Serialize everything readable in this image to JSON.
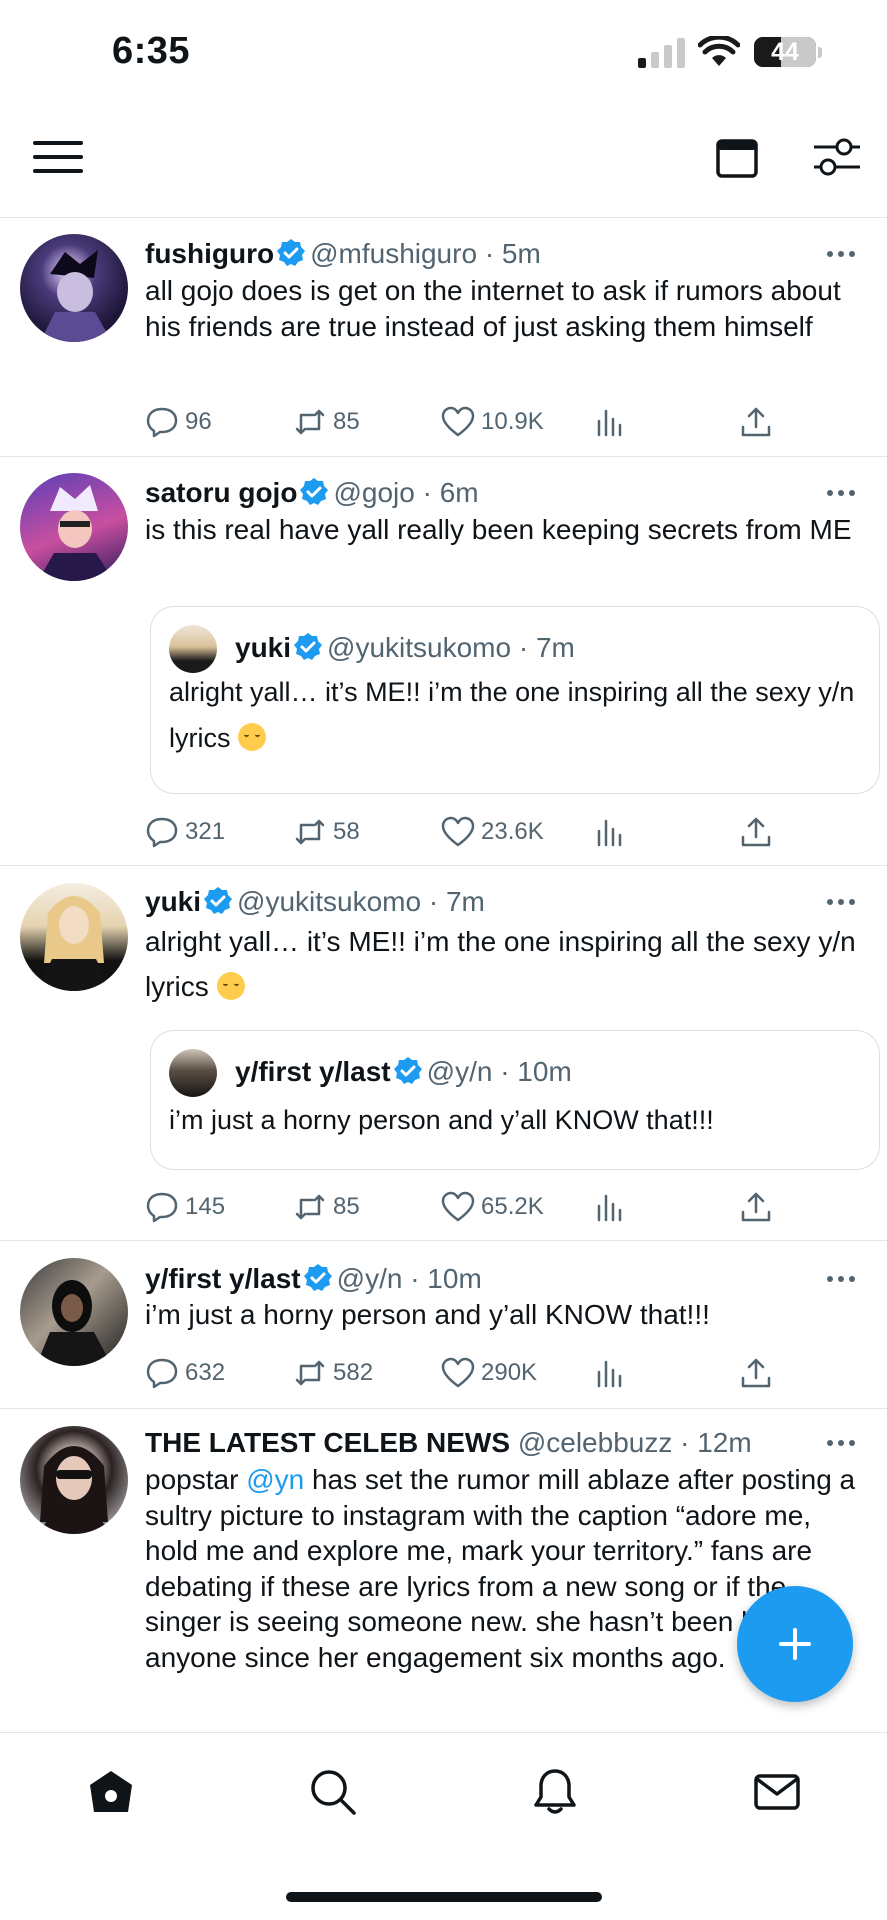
{
  "status_bar": {
    "time": "6:35",
    "battery_level": 44
  },
  "header": {
    "menu_icon": "hamburger-menu-icon",
    "calendar_icon": "calendar-icon",
    "filter_icon": "sliders-icon"
  },
  "tweets": [
    {
      "name": "fushiguro",
      "handle": "@mfushiguro",
      "time": "· 5m",
      "text": "all gojo does is get on the internet to ask if rumors about his friends are true instead of just asking them himself",
      "replies": "96",
      "retweets": "85",
      "likes": "10.9K"
    },
    {
      "name": "satoru gojo",
      "handle": "@gojo",
      "time": "· 6m",
      "text": "is this real have yall really been keeping secrets from ME",
      "quote": {
        "name": "yuki",
        "handle": "@yukitsukomo",
        "time": "· 7m",
        "text": "alright yall… it’s ME!! i’m the one inspiring all the sexy y/n lyrics"
      },
      "replies": "321",
      "retweets": "58",
      "likes": "23.6K"
    },
    {
      "name": "yuki",
      "handle": "@yukitsukomo",
      "time": "· 7m",
      "text": "alright yall… it’s ME!! i’m the one inspiring all the sexy y/n lyrics",
      "quote": {
        "name": "y/first y/last",
        "handle": "@y/n",
        "time": "· 10m",
        "text": "i’m just a horny person and y’all KNOW that!!!"
      },
      "replies": "145",
      "retweets": "85",
      "likes": "65.2K"
    },
    {
      "name": "y/first y/last",
      "handle": "@y/n",
      "time": "· 10m",
      "text": "i’m just a horny person and y’all KNOW that!!!",
      "replies": "632",
      "retweets": "582",
      "likes": "290K"
    },
    {
      "name": "THE LATEST CELEB NEWS",
      "handle": "@celebbuzz",
      "time": "· 12m",
      "text_before": "popstar",
      "mention": "@yn",
      "text_after": "has set the rumor mill ablaze after posting a sultry picture to instagram with the caption “adore me, hold me and explore me, mark your territory.” fans are debating if these are lyrics from a new song or if the singer is seeing someone new.  she hasn’t been linked to anyone since her engagement six months ago."
    }
  ],
  "bottom_nav": [
    "home-icon",
    "search-icon",
    "notifications-bell-icon",
    "messages-envelope-icon"
  ],
  "colors": {
    "accent": "#1d9bf0",
    "secondary_text": "#536471",
    "primary_text": "#0f1419"
  }
}
